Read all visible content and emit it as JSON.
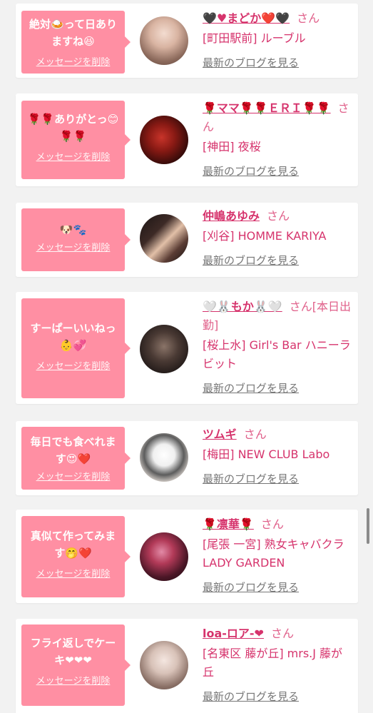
{
  "delete_label": "メッセージを削除",
  "san_label": "さん",
  "blog_label": "最新のブログを見る",
  "colors": {
    "background": "#f2f2f2",
    "bubble": "#ff8fa3",
    "name": "#d6336c",
    "link_gray": "#777777"
  },
  "items": [
    {
      "message": "絶対🍛って日ありますね😆",
      "name": "🖤♥まどか❤️🖤",
      "shop": "[町田駅前] ルーブル"
    },
    {
      "message": "🌹🌹ありがとっ😊🌹🌹",
      "name": "🌹ママ🌹🌹ＥＲＩ🌹🌹",
      "shop": "[神田] 夜桜"
    },
    {
      "message": "🐶🐾",
      "name": "仲嶋あゆみ",
      "shop": "[刈谷] HOMME KARIYA"
    },
    {
      "message": "すーぱーいいねっ👶💞",
      "name": "🤍🐰もか🐰🤍",
      "name_suffix": "[本日出勤]",
      "shop": "[桜上水] Girl's Bar ハニーラビット"
    },
    {
      "message": "毎日でも食べれます😍❤️",
      "name": "ツムギ",
      "shop": "[梅田] NEW CLUB Labo"
    },
    {
      "message": "真似て作ってみます🤭❤️",
      "name": "🌹凛華🌹",
      "shop": "[尾張 一宮] 熟女キャバクラ LADY GARDEN"
    },
    {
      "message": "フライ返しでケーキ❤❤❤",
      "name": "loa-ロア-❤",
      "shop": "[名東区 藤が丘] mrs.J 藤が丘"
    }
  ]
}
